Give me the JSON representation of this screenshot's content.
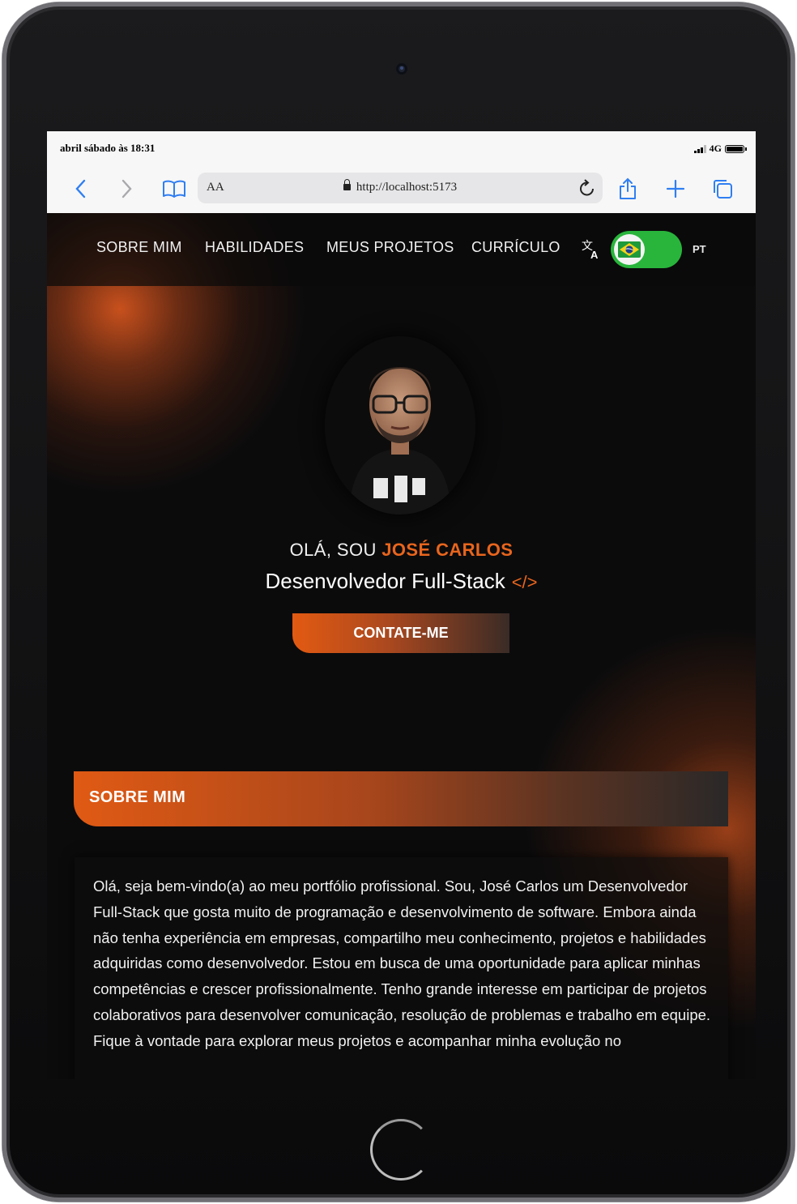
{
  "status_bar": {
    "datetime": "abril sábado às 18:31",
    "network": "4G"
  },
  "browser": {
    "reader_label": "AA",
    "url": "http://localhost:5173",
    "accent_color": "#2f7ff2"
  },
  "nav": {
    "items": [
      "SOBRE MIM",
      "HABILIDADES",
      "MEUS PROJETOS",
      "CURRÍCULO"
    ],
    "language_label": "PT",
    "toggle_color": "#29b53c"
  },
  "hero": {
    "greeting": "OLÁ, SOU",
    "name": "JOSÉ CARLOS",
    "role": "Desenvolvedor Full-Stack",
    "role_icon": "</>",
    "contact_button": "CONTATE-ME",
    "accent_color": "#e8651d"
  },
  "about": {
    "title": "SOBRE MIM",
    "text": "Olá, seja bem-vindo(a) ao meu portfólio profissional. Sou, José Carlos um Desenvolvedor Full-Stack que gosta muito de programação e desenvolvimento de software. Embora ainda não tenha experiência em empresas, compartilho meu conhecimento, projetos e habilidades adquiridas como desenvolvedor. Estou em busca de uma oportunidade para aplicar minhas competências e crescer profissionalmente. Tenho grande interesse em participar de projetos colaborativos para desenvolver comunicação, resolução de problemas e trabalho em equipe. Fique à vontade para explorar meus projetos e acompanhar minha evolução no"
  }
}
